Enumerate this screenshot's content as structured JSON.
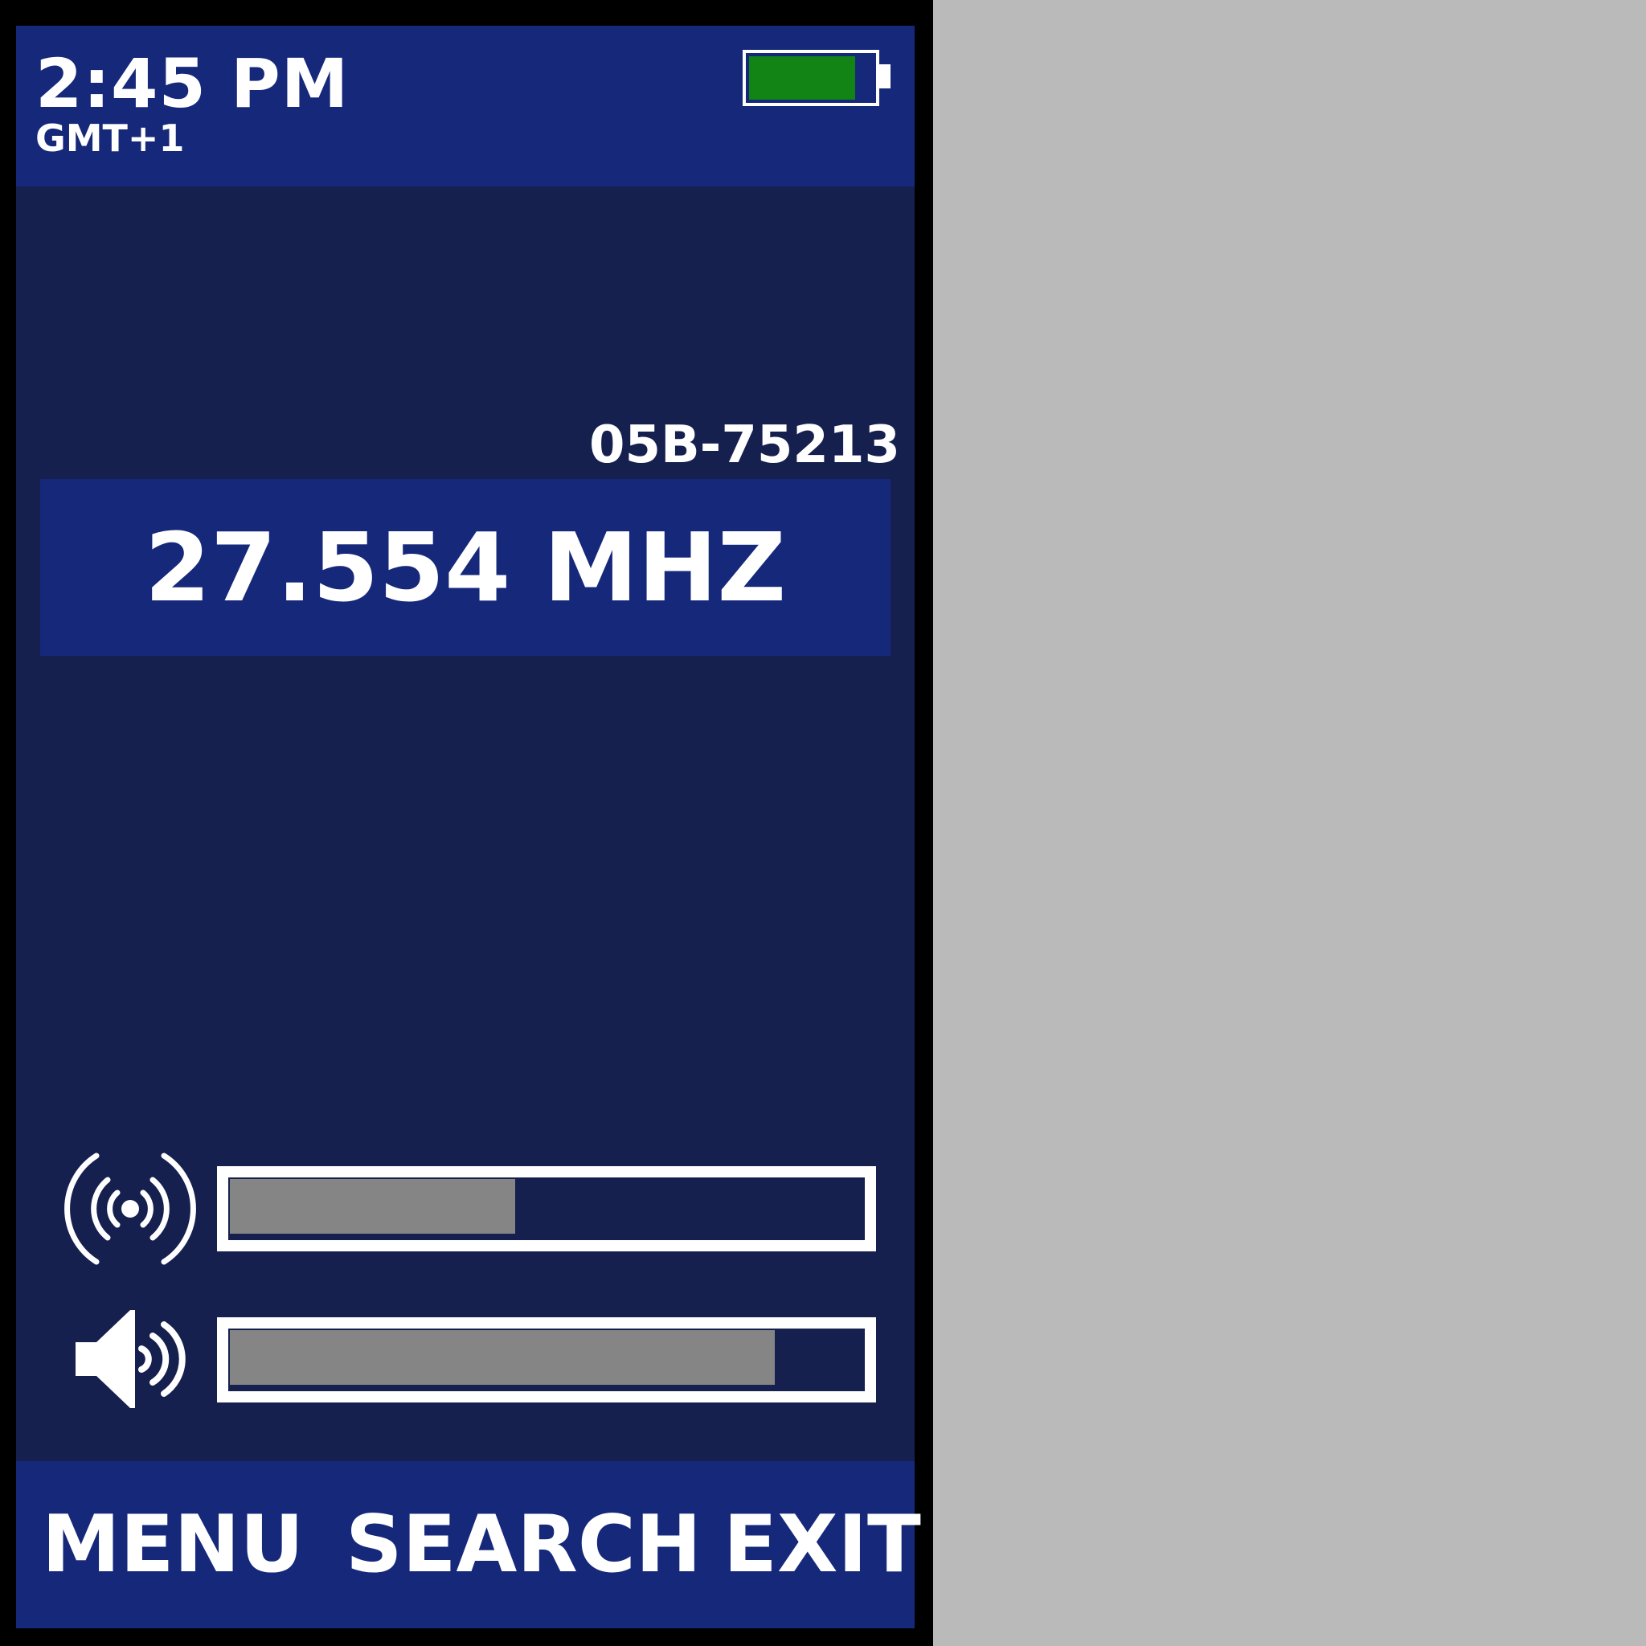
{
  "status_bar": {
    "time": "2:45 PM",
    "timezone": "GMT+1",
    "battery": {
      "level": 0.86,
      "color": "#128415"
    }
  },
  "channel": {
    "device_id": "05B-75213",
    "frequency": "27.554 MHZ"
  },
  "meters": {
    "signal": {
      "icon": "signal-icon",
      "level": 0.45
    },
    "volume": {
      "icon": "speaker-volume-icon",
      "level": 0.86
    }
  },
  "softkeys": {
    "menu_label": "MENU",
    "search_label": "SEARCH",
    "exit_label": "EXIT"
  },
  "colors": {
    "screen_bg": "#16204f",
    "panel_bg": "#16287a",
    "bezel": "#000000",
    "meter_fill": "#858585",
    "text": "#ffffff"
  }
}
